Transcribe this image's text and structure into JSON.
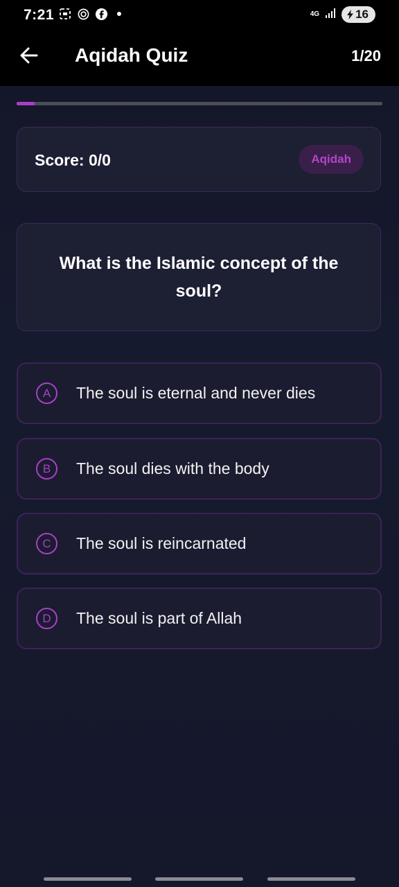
{
  "status_bar": {
    "time": "7:21",
    "network": "4G",
    "battery": "16",
    "icons": [
      "screenshot-icon",
      "openai-icon",
      "facebook-icon",
      "dot-icon"
    ]
  },
  "app_bar": {
    "title": "Aqidah Quiz",
    "counter": "1/20"
  },
  "progress": {
    "current": 1,
    "total": 20,
    "fraction": 0.05
  },
  "score": {
    "label": "Score: 0/0",
    "category": "Aqidah"
  },
  "question": {
    "text": "What is the Islamic concept of the soul?"
  },
  "options": [
    {
      "letter": "A",
      "text": "The soul is eternal and never dies"
    },
    {
      "letter": "B",
      "text": "The soul dies with the body"
    },
    {
      "letter": "C",
      "text": "The soul is reincarnated"
    },
    {
      "letter": "D",
      "text": "The soul is part of Allah"
    }
  ],
  "colors": {
    "accent": "#a93fc9",
    "background": "#15182b",
    "card": "#1d1f33",
    "border": "#3d2258"
  }
}
